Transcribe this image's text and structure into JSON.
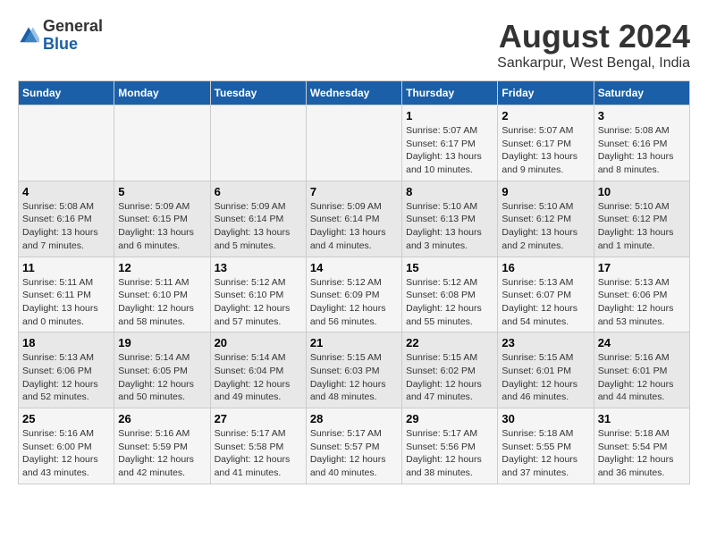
{
  "logo": {
    "text_general": "General",
    "text_blue": "Blue"
  },
  "title": "August 2024",
  "subtitle": "Sankarpur, West Bengal, India",
  "headers": [
    "Sunday",
    "Monday",
    "Tuesday",
    "Wednesday",
    "Thursday",
    "Friday",
    "Saturday"
  ],
  "weeks": [
    [
      {
        "day": "",
        "info": ""
      },
      {
        "day": "",
        "info": ""
      },
      {
        "day": "",
        "info": ""
      },
      {
        "day": "",
        "info": ""
      },
      {
        "day": "1",
        "info": "Sunrise: 5:07 AM\nSunset: 6:17 PM\nDaylight: 13 hours\nand 10 minutes."
      },
      {
        "day": "2",
        "info": "Sunrise: 5:07 AM\nSunset: 6:17 PM\nDaylight: 13 hours\nand 9 minutes."
      },
      {
        "day": "3",
        "info": "Sunrise: 5:08 AM\nSunset: 6:16 PM\nDaylight: 13 hours\nand 8 minutes."
      }
    ],
    [
      {
        "day": "4",
        "info": "Sunrise: 5:08 AM\nSunset: 6:16 PM\nDaylight: 13 hours\nand 7 minutes."
      },
      {
        "day": "5",
        "info": "Sunrise: 5:09 AM\nSunset: 6:15 PM\nDaylight: 13 hours\nand 6 minutes."
      },
      {
        "day": "6",
        "info": "Sunrise: 5:09 AM\nSunset: 6:14 PM\nDaylight: 13 hours\nand 5 minutes."
      },
      {
        "day": "7",
        "info": "Sunrise: 5:09 AM\nSunset: 6:14 PM\nDaylight: 13 hours\nand 4 minutes."
      },
      {
        "day": "8",
        "info": "Sunrise: 5:10 AM\nSunset: 6:13 PM\nDaylight: 13 hours\nand 3 minutes."
      },
      {
        "day": "9",
        "info": "Sunrise: 5:10 AM\nSunset: 6:12 PM\nDaylight: 13 hours\nand 2 minutes."
      },
      {
        "day": "10",
        "info": "Sunrise: 5:10 AM\nSunset: 6:12 PM\nDaylight: 13 hours\nand 1 minute."
      }
    ],
    [
      {
        "day": "11",
        "info": "Sunrise: 5:11 AM\nSunset: 6:11 PM\nDaylight: 13 hours\nand 0 minutes."
      },
      {
        "day": "12",
        "info": "Sunrise: 5:11 AM\nSunset: 6:10 PM\nDaylight: 12 hours\nand 58 minutes."
      },
      {
        "day": "13",
        "info": "Sunrise: 5:12 AM\nSunset: 6:10 PM\nDaylight: 12 hours\nand 57 minutes."
      },
      {
        "day": "14",
        "info": "Sunrise: 5:12 AM\nSunset: 6:09 PM\nDaylight: 12 hours\nand 56 minutes."
      },
      {
        "day": "15",
        "info": "Sunrise: 5:12 AM\nSunset: 6:08 PM\nDaylight: 12 hours\nand 55 minutes."
      },
      {
        "day": "16",
        "info": "Sunrise: 5:13 AM\nSunset: 6:07 PM\nDaylight: 12 hours\nand 54 minutes."
      },
      {
        "day": "17",
        "info": "Sunrise: 5:13 AM\nSunset: 6:06 PM\nDaylight: 12 hours\nand 53 minutes."
      }
    ],
    [
      {
        "day": "18",
        "info": "Sunrise: 5:13 AM\nSunset: 6:06 PM\nDaylight: 12 hours\nand 52 minutes."
      },
      {
        "day": "19",
        "info": "Sunrise: 5:14 AM\nSunset: 6:05 PM\nDaylight: 12 hours\nand 50 minutes."
      },
      {
        "day": "20",
        "info": "Sunrise: 5:14 AM\nSunset: 6:04 PM\nDaylight: 12 hours\nand 49 minutes."
      },
      {
        "day": "21",
        "info": "Sunrise: 5:15 AM\nSunset: 6:03 PM\nDaylight: 12 hours\nand 48 minutes."
      },
      {
        "day": "22",
        "info": "Sunrise: 5:15 AM\nSunset: 6:02 PM\nDaylight: 12 hours\nand 47 minutes."
      },
      {
        "day": "23",
        "info": "Sunrise: 5:15 AM\nSunset: 6:01 PM\nDaylight: 12 hours\nand 46 minutes."
      },
      {
        "day": "24",
        "info": "Sunrise: 5:16 AM\nSunset: 6:01 PM\nDaylight: 12 hours\nand 44 minutes."
      }
    ],
    [
      {
        "day": "25",
        "info": "Sunrise: 5:16 AM\nSunset: 6:00 PM\nDaylight: 12 hours\nand 43 minutes."
      },
      {
        "day": "26",
        "info": "Sunrise: 5:16 AM\nSunset: 5:59 PM\nDaylight: 12 hours\nand 42 minutes."
      },
      {
        "day": "27",
        "info": "Sunrise: 5:17 AM\nSunset: 5:58 PM\nDaylight: 12 hours\nand 41 minutes."
      },
      {
        "day": "28",
        "info": "Sunrise: 5:17 AM\nSunset: 5:57 PM\nDaylight: 12 hours\nand 40 minutes."
      },
      {
        "day": "29",
        "info": "Sunrise: 5:17 AM\nSunset: 5:56 PM\nDaylight: 12 hours\nand 38 minutes."
      },
      {
        "day": "30",
        "info": "Sunrise: 5:18 AM\nSunset: 5:55 PM\nDaylight: 12 hours\nand 37 minutes."
      },
      {
        "day": "31",
        "info": "Sunrise: 5:18 AM\nSunset: 5:54 PM\nDaylight: 12 hours\nand 36 minutes."
      }
    ]
  ]
}
